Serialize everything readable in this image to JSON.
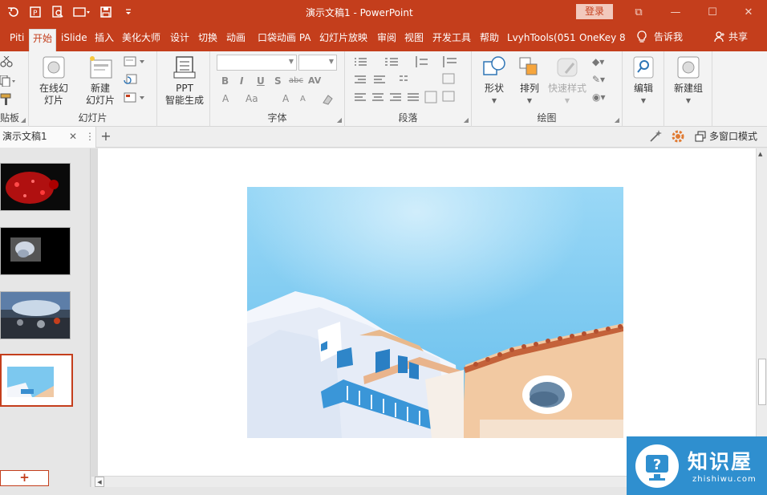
{
  "window": {
    "title": "演示文稿1 - PowerPoint",
    "login_label": "登录",
    "controls": {
      "restore_ribbon": "⧉",
      "minimize": "—",
      "maximize": "☐",
      "close": "✕"
    }
  },
  "quick_access": [
    "undo-icon",
    "ppt-icon",
    "print-preview-icon",
    "screenshot-icon",
    "save-icon",
    "customize-icon"
  ],
  "tabs": [
    "Piti",
    "开始",
    "iSlide",
    "插入",
    "美化大师",
    "设计",
    "切换",
    "动画",
    "口袋动画 PA",
    "幻灯片放映",
    "审阅",
    "视图",
    "开发工具",
    "帮助",
    "LvyhTools(051",
    "OneKey 8"
  ],
  "active_tab": "开始",
  "tell_me": "告诉我",
  "share": "共享",
  "ribbon": {
    "clipboard_label": "贴板",
    "online_slides": "在线幻\n灯片",
    "new_slide": "新建\n幻灯片",
    "slides_group": "幻灯片",
    "ppt_gen": "PPT\n智能生成",
    "font_group": "字体",
    "paragraph_group": "段落",
    "shape": "形状",
    "arrange": "排列",
    "quick_styles": "快速样式",
    "drawing_group": "绘图",
    "edit": "编辑",
    "new_group": "新建组",
    "font_buttons": [
      "B",
      "I",
      "U",
      "S",
      "abc",
      "AV",
      "A",
      "Aa",
      "A",
      "A"
    ]
  },
  "pane": {
    "doc_tab": "演示文稿1",
    "close_glyph": "✕",
    "more_glyph": "⋮",
    "add_glyph": "+",
    "multi_window": "多窗口模式"
  },
  "slides_panel": {
    "add_button": "+",
    "thumbnails": [
      "slide-1",
      "slide-2",
      "slide-3",
      "slide-4"
    ],
    "selected_index": 3
  },
  "watermark": {
    "title": "知识屋",
    "subtitle": "zhishiwu.com"
  },
  "colors": {
    "accent": "#c43e1c",
    "ribbon": "#f3f3f3",
    "sky": "#7cc8ef",
    "watermark": "#2f8fcf"
  }
}
